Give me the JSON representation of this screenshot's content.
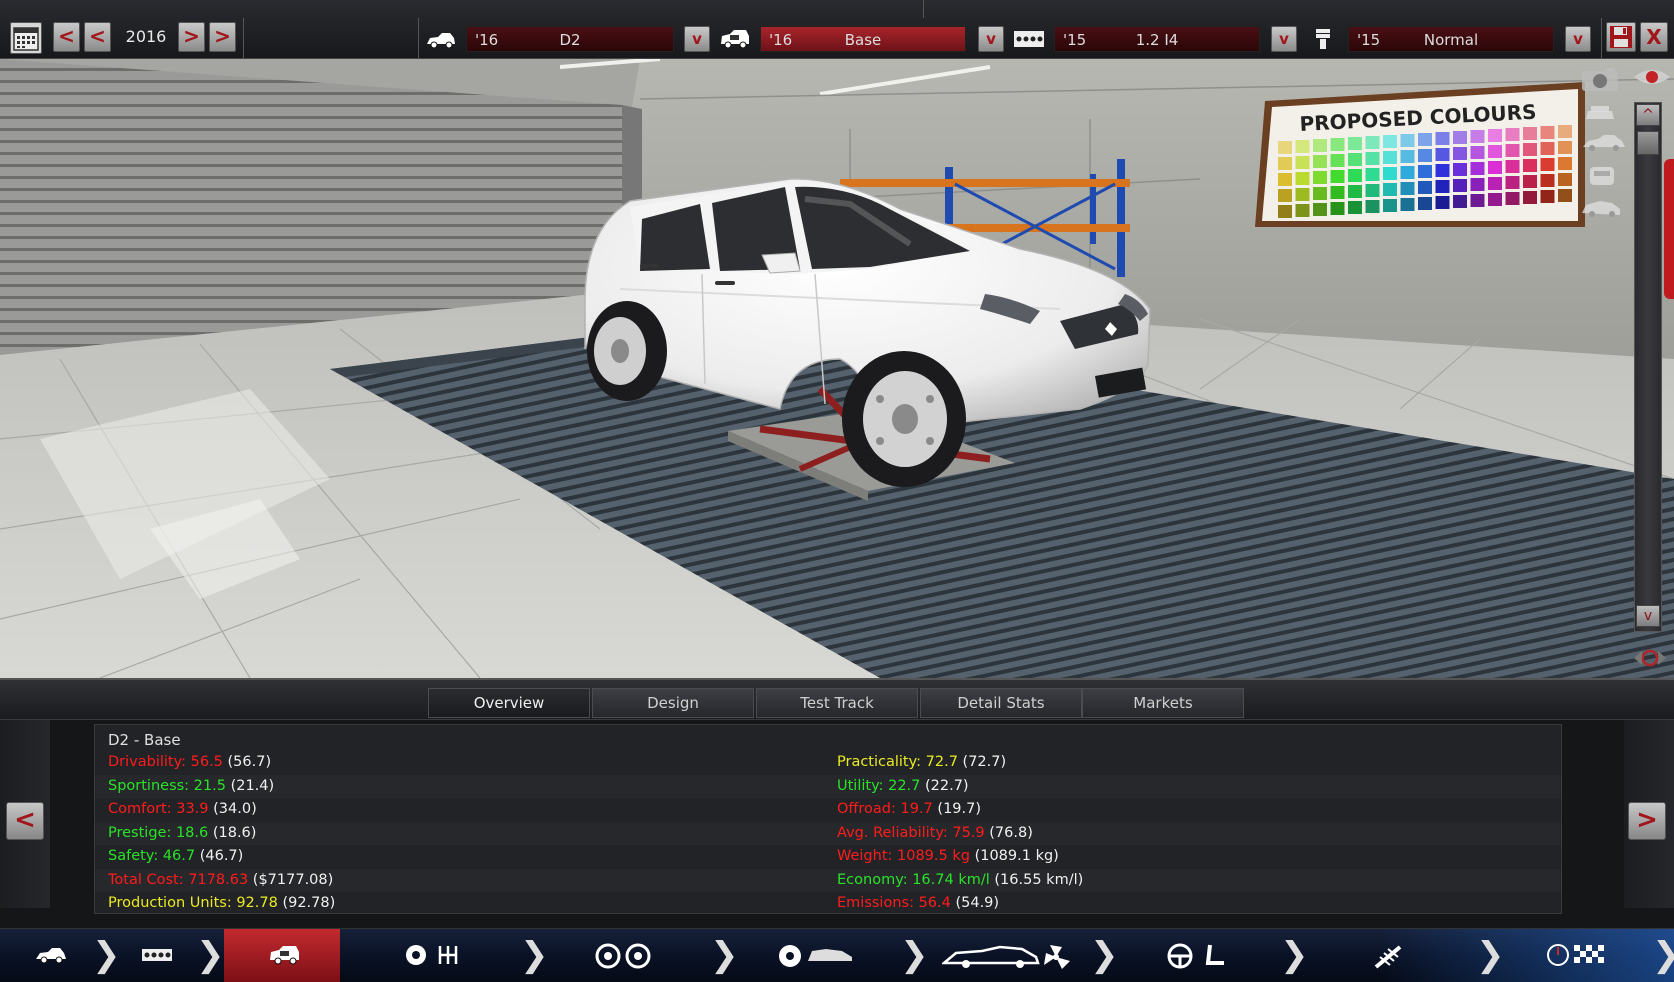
{
  "topbar": {
    "calendar_icon": "calendar-icon",
    "prev_fast_label": "<",
    "prev_label": "<",
    "year": "2016",
    "next_label": ">",
    "next_fast_label": ">",
    "model": {
      "year": "'16",
      "name": "D2",
      "dropdown": "v",
      "icon": "car-model-icon"
    },
    "trim": {
      "year": "'16",
      "name": "Base",
      "dropdown": "v",
      "icon": "car-trim-icon"
    },
    "engine": {
      "year": "'15",
      "name": "1.2 I4",
      "dropdown": "v",
      "icon": "engine-block-icon"
    },
    "engine_variant": {
      "year": "'15",
      "name": "Normal",
      "dropdown": "v",
      "icon": "piston-icon"
    },
    "save_icon": "save-icon",
    "close_label": "X"
  },
  "viewport": {
    "poster_text": "PROPOSED COLOURS",
    "camera_icon": "camera-icon",
    "eye_icon": "eye-icon",
    "view_icons": [
      "car-front-view-icon",
      "car-side-view-icon",
      "car-top-view-icon",
      "car-3q-view-icon"
    ],
    "scroll_up": "^",
    "scroll_down": "v"
  },
  "tabs": [
    {
      "label": "Overview",
      "active": true
    },
    {
      "label": "Design",
      "active": false
    },
    {
      "label": "Test Track",
      "active": false
    },
    {
      "label": "Detail Stats",
      "active": false
    },
    {
      "label": "Markets",
      "active": false
    }
  ],
  "nav": {
    "prev": "<",
    "next": ">"
  },
  "overview": {
    "title": "D2 - Base",
    "left": [
      {
        "label": "Drivability: 56.5",
        "ref": "(56.7)",
        "color": "#ff1c1c"
      },
      {
        "label": "Sportiness: 21.5",
        "ref": "(21.4)",
        "color": "#29e329"
      },
      {
        "label": "Comfort: 33.9",
        "ref": "(34.0)",
        "color": "#ff1c1c"
      },
      {
        "label": "Prestige: 18.6",
        "ref": "(18.6)",
        "color": "#29e329"
      },
      {
        "label": "Safety: 46.7",
        "ref": "(46.7)",
        "color": "#29e329"
      },
      {
        "label": "Total Cost: 7178.63",
        "ref": "($7177.08)",
        "color": "#ff1c1c"
      },
      {
        "label": "Production Units: 92.78",
        "ref": "(92.78)",
        "color": "#eaea23"
      }
    ],
    "right": [
      {
        "label": "Practicality: 72.7",
        "ref": "(72.7)",
        "color": "#eaea23"
      },
      {
        "label": "Utility: 22.7",
        "ref": "(22.7)",
        "color": "#29e329"
      },
      {
        "label": "Offroad: 19.7",
        "ref": "(19.7)",
        "color": "#ff1c1c"
      },
      {
        "label": "Avg. Reliability: 75.9",
        "ref": "(76.8)",
        "color": "#ff1c1c"
      },
      {
        "label": "Weight: 1089.5 kg",
        "ref": "(1089.1 kg)",
        "color": "#ff1c1c"
      },
      {
        "label": "Economy: 16.74 km/l",
        "ref": "(16.55 km/l)",
        "color": "#29e329"
      },
      {
        "label": "Emissions: 56.4",
        "ref": "(54.9)",
        "color": "#ff1c1c"
      }
    ]
  },
  "bottom_nav": {
    "steps": [
      "car-model-step-icon",
      "engine-step-icon",
      "trim-step-icon",
      "gearbox-step-icon",
      "wheels-step-icon",
      "body-design-step-icon",
      "aero-step-icon",
      "interior-step-icon",
      "suspension-step-icon",
      "test-track-step-icon"
    ],
    "active_index": 2
  }
}
